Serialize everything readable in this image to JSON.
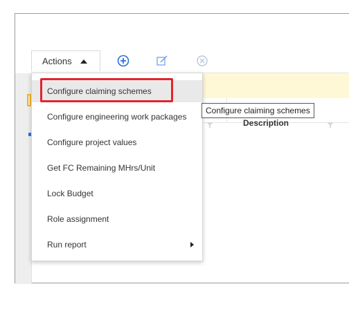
{
  "toolbar": {
    "actions_label": "Actions",
    "icons": [
      "add-circle-icon",
      "edit-icon",
      "cancel-circle-icon"
    ]
  },
  "grid": {
    "description_header": "Description"
  },
  "menu": {
    "items": [
      {
        "label": "Configure claiming schemes",
        "active": true
      },
      {
        "label": "Configure engineering work packages"
      },
      {
        "label": "Configure project values"
      },
      {
        "label": "Get FC Remaining MHrs/Unit"
      },
      {
        "label": "Lock Budget"
      },
      {
        "label": "Role assignment"
      },
      {
        "label": "Run report",
        "has_submenu": true
      }
    ]
  },
  "tooltip": {
    "text": "Configure claiming schemes"
  },
  "colors": {
    "highlight": "#e3232e",
    "icon_blue": "#2e6fd6",
    "icon_blue_light": "#7fa8e8",
    "icon_grey": "#b8c6dc",
    "banner": "#fff8d6"
  }
}
